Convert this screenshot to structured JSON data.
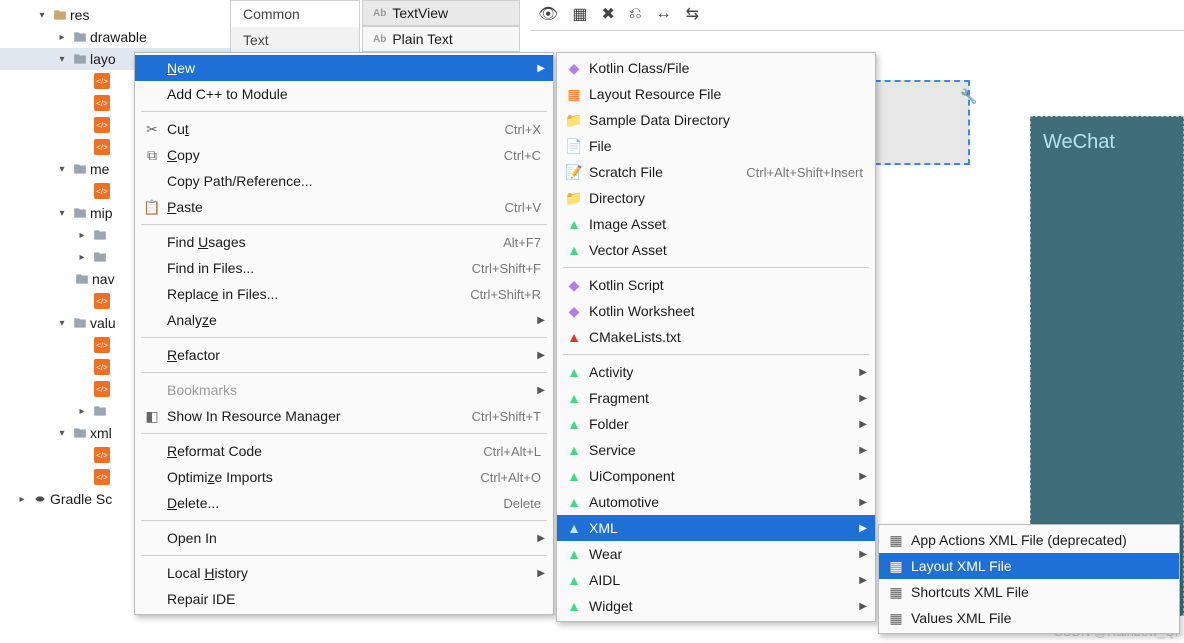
{
  "tree": {
    "res": "res",
    "drawable": "drawable",
    "layout": "layo",
    "menu": "me",
    "mipmap": "mip",
    "nav": "nav",
    "values": "valu",
    "xml": "xml",
    "gradle": "Gradle Sc"
  },
  "palette": {
    "common": "Common",
    "text": "Text"
  },
  "chips": {
    "textview": "TextView",
    "plaintext": "Plain Text",
    "ab": "Ab"
  },
  "preview": {
    "wechat": "WeChat"
  },
  "watermark": "CSDN @Rainbow_Qi",
  "menu1": {
    "new": "New",
    "addcpp": "Add C++ to Module",
    "cut": "Cut",
    "cut_s": "Ctrl+X",
    "copy": "Copy",
    "copy_s": "Ctrl+C",
    "copypath": "Copy Path/Reference...",
    "paste": "Paste",
    "paste_s": "Ctrl+V",
    "findusages": "Find Usages",
    "findusages_s": "Alt+F7",
    "findinfiles": "Find in Files...",
    "findinfiles_s": "Ctrl+Shift+F",
    "replaceinfiles": "Replace in Files...",
    "replaceinfiles_s": "Ctrl+Shift+R",
    "analyze": "Analyze",
    "refactor": "Refactor",
    "bookmarks": "Bookmarks",
    "showres": "Show In Resource Manager",
    "showres_s": "Ctrl+Shift+T",
    "reformat": "Reformat Code",
    "reformat_s": "Ctrl+Alt+L",
    "optimize": "Optimize Imports",
    "optimize_s": "Ctrl+Alt+O",
    "delete": "Delete...",
    "delete_s": "Delete",
    "openin": "Open In",
    "localhist": "Local History",
    "repairide": "Repair IDE"
  },
  "menu2": {
    "kotlinclass": "Kotlin Class/File",
    "layoutres": "Layout Resource File",
    "sampledata": "Sample Data Directory",
    "file": "File",
    "scratch": "Scratch File",
    "scratch_s": "Ctrl+Alt+Shift+Insert",
    "directory": "Directory",
    "imageasset": "Image Asset",
    "vectorasset": "Vector Asset",
    "kotlinscript": "Kotlin Script",
    "kotlinws": "Kotlin Worksheet",
    "cmake": "CMakeLists.txt",
    "activity": "Activity",
    "fragment": "Fragment",
    "folder": "Folder",
    "service": "Service",
    "uicomponent": "UiComponent",
    "automotive": "Automotive",
    "xml": "XML",
    "wear": "Wear",
    "aidl": "AIDL",
    "widget": "Widget"
  },
  "menu3": {
    "appactions": "App Actions XML File (deprecated)",
    "layoutxml": "Layout XML File",
    "shortcuts": "Shortcuts XML File",
    "valuesxml": "Values XML File"
  }
}
